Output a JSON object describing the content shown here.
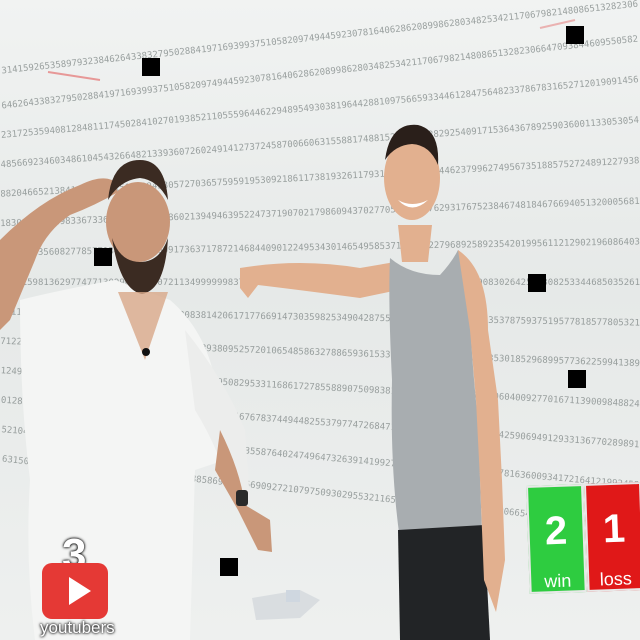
{
  "overlay": {
    "youtubers": {
      "count": "3",
      "label": "youtubers",
      "icon": "youtube-play-icon",
      "color": "#e53935"
    },
    "scoreboard": {
      "win": {
        "value": "2",
        "label": "win",
        "color": "#2ecc40"
      },
      "loss": {
        "value": "1",
        "label": "loss",
        "color": "#e01818"
      }
    }
  }
}
